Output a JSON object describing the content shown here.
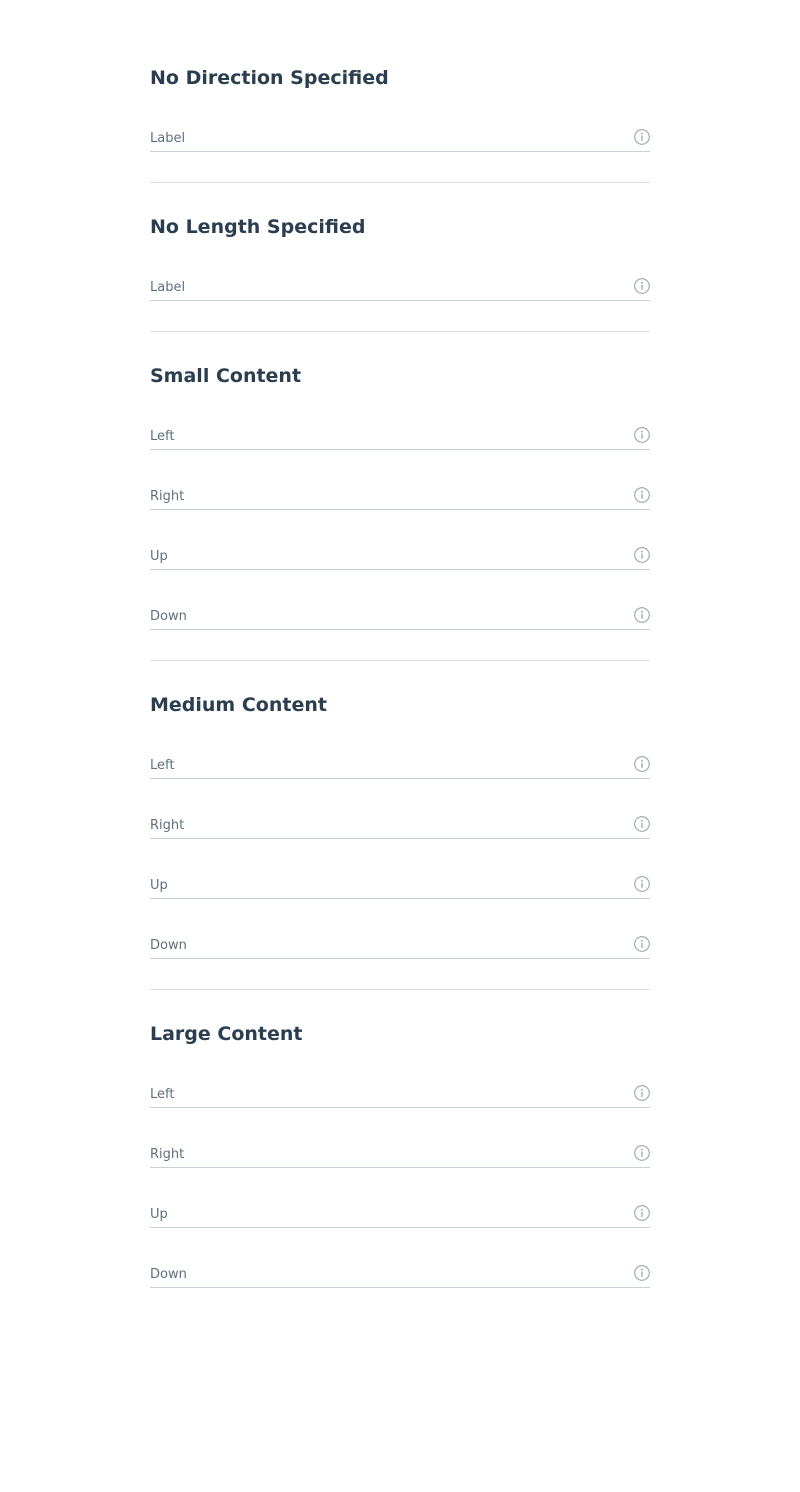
{
  "sections": [
    {
      "title": "No Direction Specified",
      "fields": [
        {
          "label": "Label",
          "icon": "info-icon"
        }
      ]
    },
    {
      "title": "No Length Specified",
      "fields": [
        {
          "label": "Label",
          "icon": "info-icon"
        }
      ]
    },
    {
      "title": "Small Content",
      "fields": [
        {
          "label": "Left",
          "icon": "info-icon"
        },
        {
          "label": "Right",
          "icon": "info-icon"
        },
        {
          "label": "Up",
          "icon": "info-icon"
        },
        {
          "label": "Down",
          "icon": "info-icon"
        }
      ]
    },
    {
      "title": "Medium Content",
      "fields": [
        {
          "label": "Left",
          "icon": "info-icon"
        },
        {
          "label": "Right",
          "icon": "info-icon"
        },
        {
          "label": "Up",
          "icon": "info-icon"
        },
        {
          "label": "Down",
          "icon": "info-icon"
        }
      ]
    },
    {
      "title": "Large Content",
      "fields": [
        {
          "label": "Left",
          "icon": "info-icon"
        },
        {
          "label": "Right",
          "icon": "info-icon"
        },
        {
          "label": "Up",
          "icon": "info-icon"
        },
        {
          "label": "Down",
          "icon": "info-icon"
        }
      ]
    }
  ],
  "colors": {
    "heading": "#2b3e50",
    "label": "#5f6f7e",
    "field_underline": "#c9d2da",
    "divider": "#d7dde3",
    "icon": "#9aa5af"
  }
}
